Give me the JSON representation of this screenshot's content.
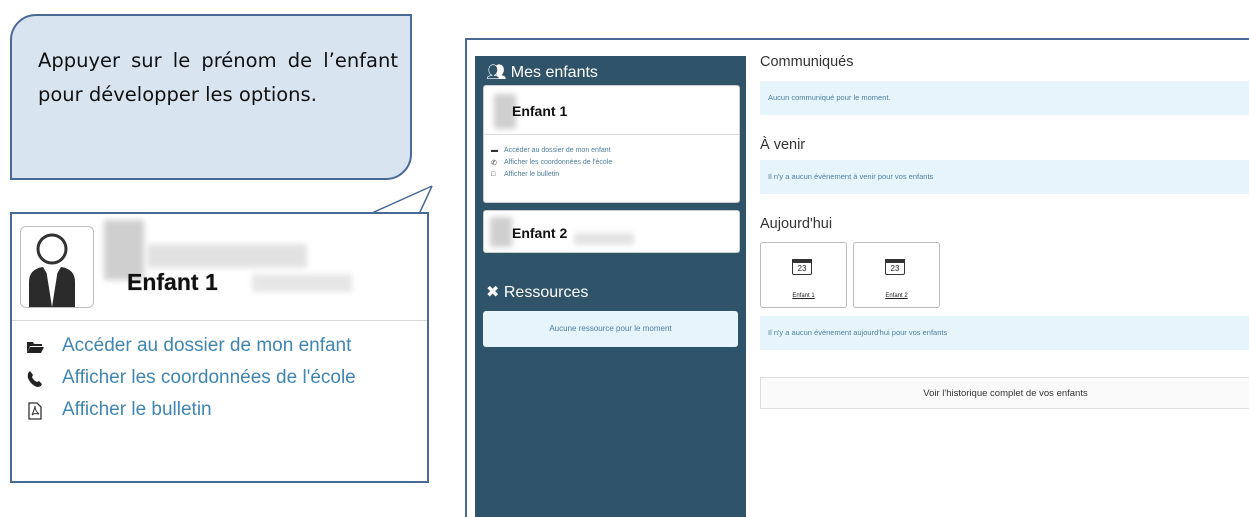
{
  "callout": {
    "text": "Appuyer sur le prénom de l’enfant pour développer les options."
  },
  "zoom": {
    "child_name": "Enfant 1",
    "links": [
      {
        "label": "Accéder au dossier de mon enfant",
        "icon": "folder-icon"
      },
      {
        "label": "Afficher les coordonnées de l'école",
        "icon": "phone-icon"
      },
      {
        "label": "Afficher le bulletin",
        "icon": "pdf-icon"
      }
    ],
    "link_color": "#3f86b3"
  },
  "sidebar": {
    "bg_color": "#2f5368",
    "my_children_title": "Mes enfants",
    "children": [
      {
        "name": "Enfant 1",
        "links": [
          "Accéder au dossier de mon enfant",
          "Afficher les coordonnées de l'école",
          "Afficher le bulletin"
        ]
      },
      {
        "name": "Enfant 2"
      }
    ],
    "resources_title": "Ressources",
    "resources_empty": "Aucune ressource pour le moment"
  },
  "main": {
    "communiques_title": "Communiqués",
    "communiques_empty": "Aucun communiqué pour le moment.",
    "avenir_title": "À venir",
    "avenir_empty": "Il n'y a aucun évènement à venir pour vos enfants",
    "today_title": "Aujourd'hui",
    "today_cards": [
      {
        "day": "23",
        "label": "Enfant 1"
      },
      {
        "day": "23",
        "label": "Enfant 2"
      }
    ],
    "today_empty": "Il n'y a aucun évènement aujourd'hui pour vos enfants",
    "history_button": "Voir l'historique complet de vos enfants"
  }
}
